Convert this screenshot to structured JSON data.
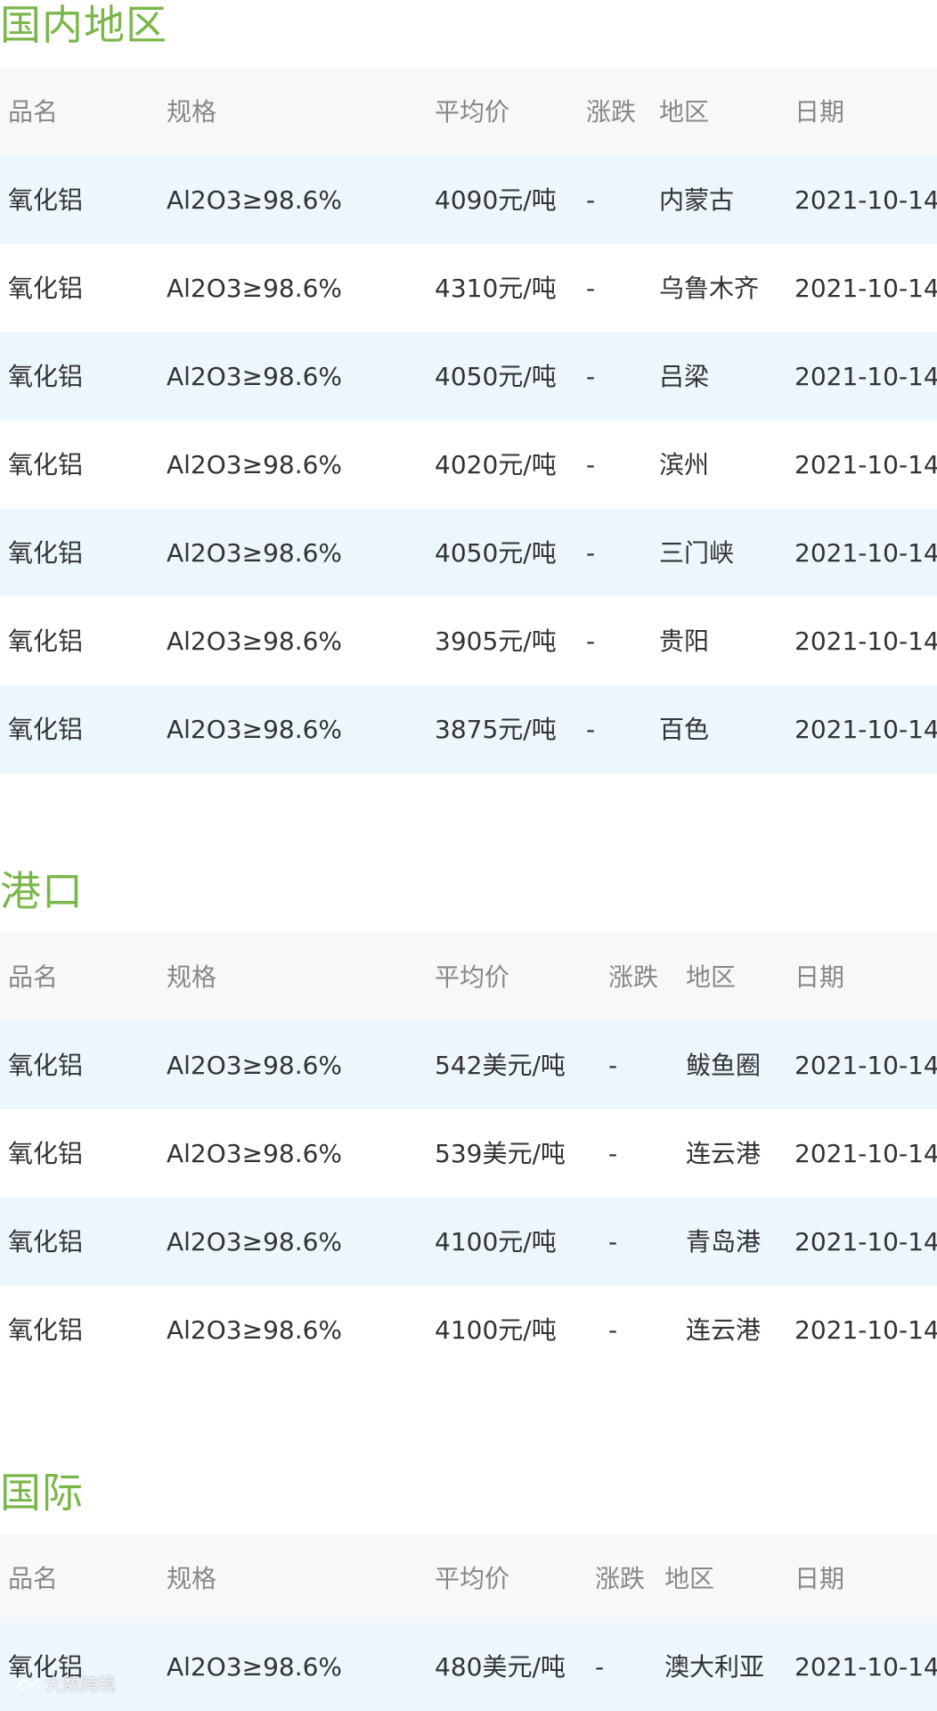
{
  "sections": [
    {
      "title": "国内地区",
      "headers": [
        "品名",
        "规格",
        "平均价",
        "涨跌",
        "地区",
        "日期"
      ],
      "rows": [
        [
          "氧化铝",
          "Al2O3≥98.6%",
          "4090元/吨",
          "-",
          "内蒙古",
          "2021-10-14"
        ],
        [
          "氧化铝",
          "Al2O3≥98.6%",
          "4310元/吨",
          "-",
          "乌鲁木齐",
          "2021-10-14"
        ],
        [
          "氧化铝",
          "Al2O3≥98.6%",
          "4050元/吨",
          "-",
          "吕梁",
          "2021-10-14"
        ],
        [
          "氧化铝",
          "Al2O3≥98.6%",
          "4020元/吨",
          "-",
          "滨州",
          "2021-10-14"
        ],
        [
          "氧化铝",
          "Al2O3≥98.6%",
          "4050元/吨",
          "-",
          "三门峡",
          "2021-10-14"
        ],
        [
          "氧化铝",
          "Al2O3≥98.6%",
          "3905元/吨",
          "-",
          "贵阳",
          "2021-10-14"
        ],
        [
          "氧化铝",
          "Al2O3≥98.6%",
          "3875元/吨",
          "-",
          "百色",
          "2021-10-14"
        ]
      ]
    },
    {
      "title": "港口",
      "headers": [
        "品名",
        "规格",
        "平均价",
        "涨跌",
        "地区",
        "日期"
      ],
      "rows": [
        [
          "氧化铝",
          "Al2O3≥98.6%",
          "542美元/吨",
          "-",
          "鲅鱼圈",
          "2021-10-14"
        ],
        [
          "氧化铝",
          "Al2O3≥98.6%",
          "539美元/吨",
          "-",
          "连云港",
          "2021-10-14"
        ],
        [
          "氧化铝",
          "Al2O3≥98.6%",
          "4100元/吨",
          "-",
          "青岛港",
          "2021-10-14"
        ],
        [
          "氧化铝",
          "Al2O3≥98.6%",
          "4100元/吨",
          "-",
          "连云港",
          "2021-10-14"
        ]
      ]
    },
    {
      "title": "国际",
      "headers": [
        "品名",
        "规格",
        "平均价",
        "涨跌",
        "地区",
        "日期"
      ],
      "rows": [
        [
          "氧化铝",
          "Al2O3≥98.6%",
          "480美元/吨",
          "-",
          "澳大利亚",
          "2021-10-14"
        ]
      ]
    }
  ],
  "watermark": {
    "text": "大数跨境",
    "logo_icon": "brand-logo-icon"
  },
  "colors": {
    "section_title": "#7bb64b",
    "header_row_bg": "#f6f8f9",
    "stripe_row_bg": "#ecf6fd",
    "plain_row_bg": "#ffffff"
  }
}
